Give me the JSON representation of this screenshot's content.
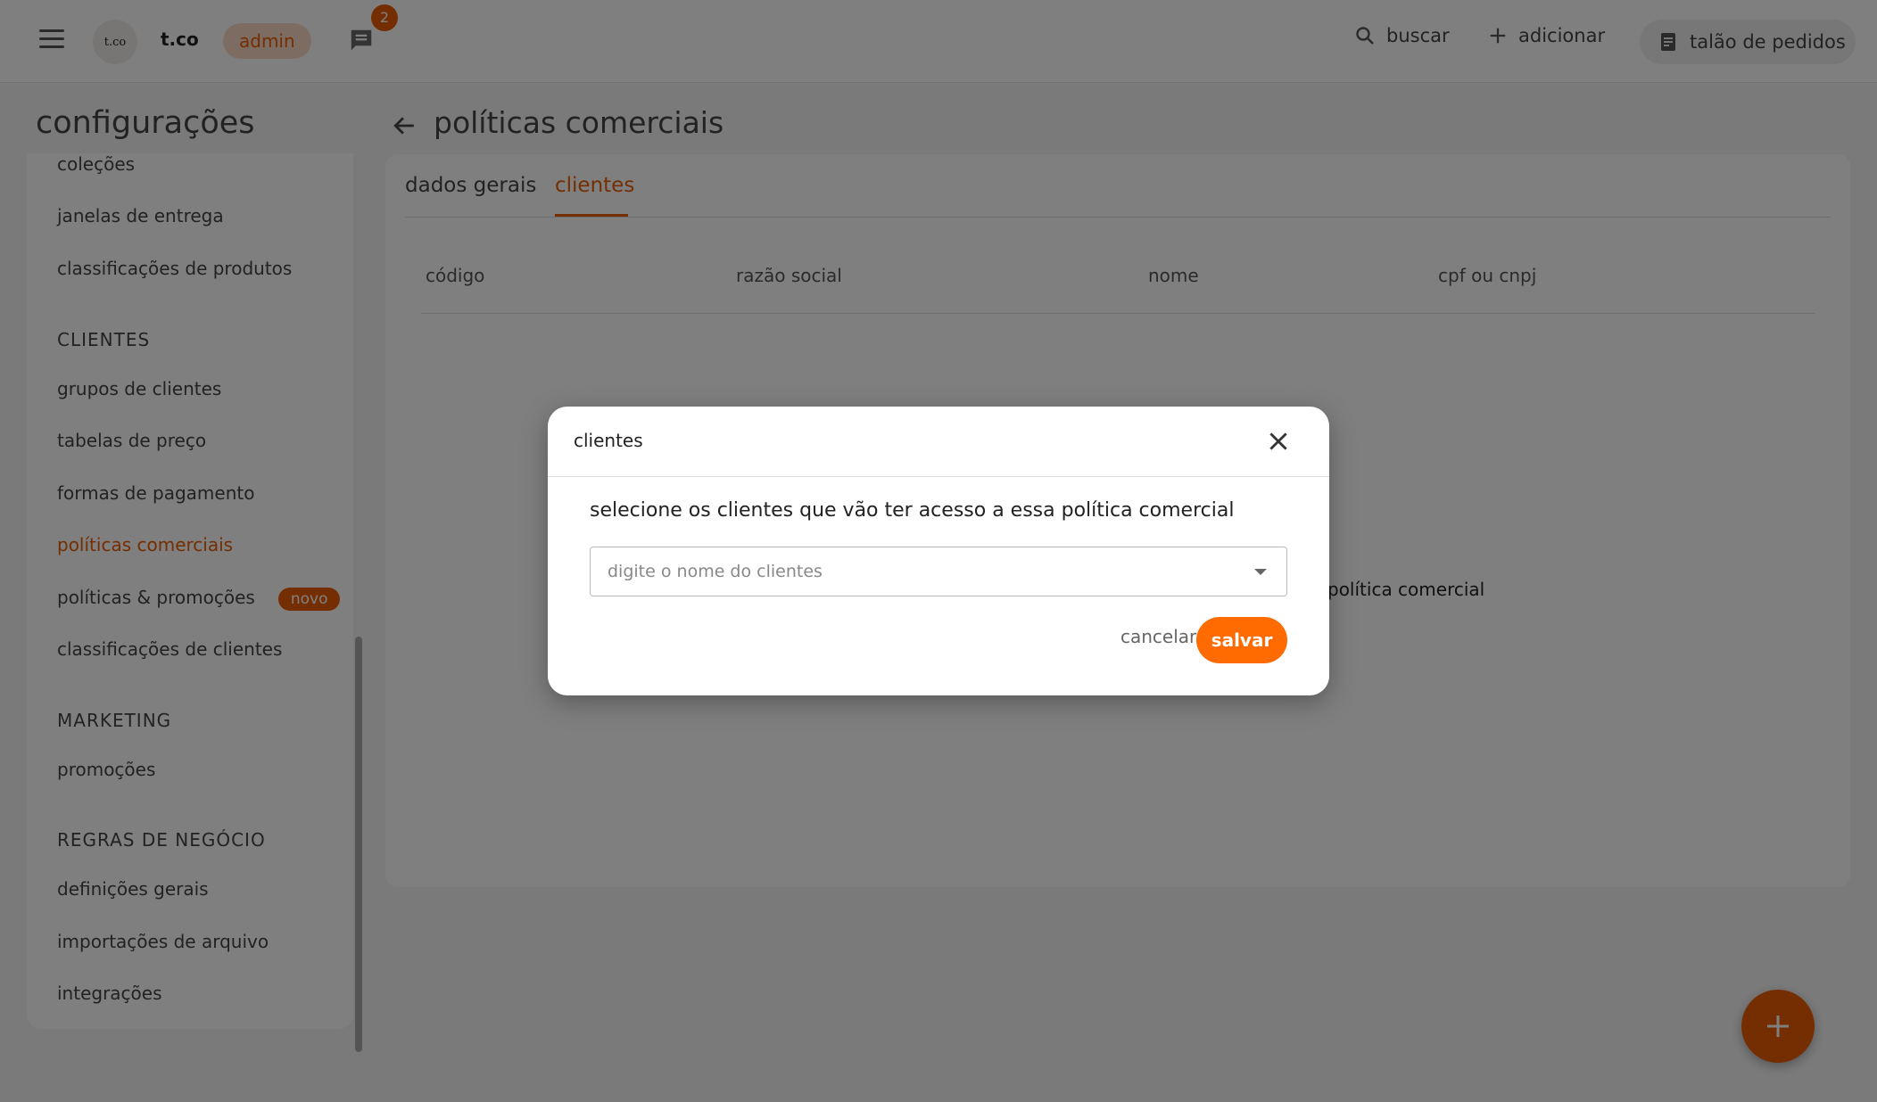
{
  "topbar": {
    "avatar_text": "t.co",
    "brand": "t.co",
    "role": "admin",
    "chat_badge": "2",
    "search_label": "buscar",
    "add_label": "adicionar",
    "talao_label": "talão de pedidos"
  },
  "sidebar": {
    "title": "configurações",
    "items": {
      "colecoes": "coleções",
      "janelas": "janelas de entrega",
      "classif_produtos": "classificações de produtos",
      "section_clientes": "CLIENTES",
      "grupos": "grupos de clientes",
      "tabelas": "tabelas de preço",
      "formas": "formas de pagamento",
      "politicas": "políticas comerciais",
      "politicas_promocoes": "políticas & promoções",
      "novo_badge": "novo",
      "classif_clientes": "classificações de clientes",
      "section_marketing": "MARKETING",
      "promocoes": "promoções",
      "section_regras": "REGRAS DE NEGÓCIO",
      "definicoes": "definições gerais",
      "importacoes": "importações de arquivo",
      "integracoes": "integrações"
    }
  },
  "main": {
    "title": "políticas comerciais",
    "tabs": [
      "dados gerais",
      "clientes"
    ],
    "columns": [
      "código",
      "razão social",
      "nome",
      "cpf ou cnpj"
    ],
    "empty_text": "política comercial"
  },
  "modal": {
    "title": "clientes",
    "text": "selecione os clientes que vão ter acesso a essa política comercial",
    "select_placeholder": "digite o nome do clientes",
    "cancel_label": "cancelar",
    "save_label": "salvar"
  },
  "colors": {
    "accent": "#e85d04",
    "save_button": "#ff6b00"
  }
}
